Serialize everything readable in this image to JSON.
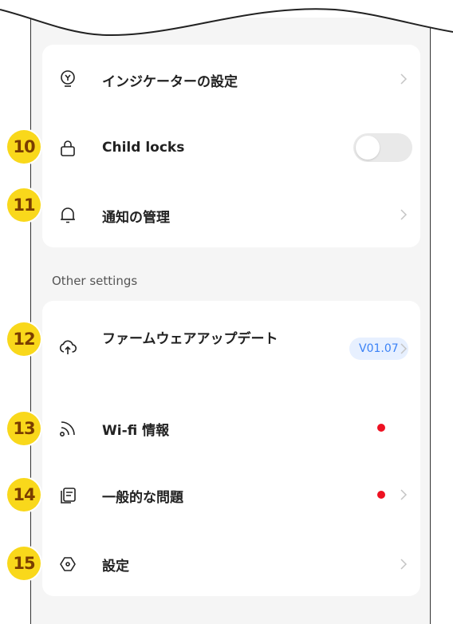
{
  "card1": {
    "rows": [
      {
        "label": "インジケーターの設定",
        "icon": "indicator-icon"
      },
      {
        "label": "Child locks",
        "icon": "lock-icon",
        "toggle": false
      },
      {
        "label": "通知の管理",
        "icon": "bell-icon"
      }
    ]
  },
  "section": {
    "other_settings": "Other settings"
  },
  "card2": {
    "rows": [
      {
        "label": "ファームウェアアップデート",
        "icon": "cloud-upload-icon",
        "version": "V01.07"
      },
      {
        "label": "Wi-fi 情報",
        "icon": "wifi-icon",
        "dot_color": "#ee1122"
      },
      {
        "label": "一般的な問題",
        "icon": "faq-icon",
        "dot_color": "#ee1122"
      },
      {
        "label": "設定",
        "icon": "settings-hexagon-icon"
      }
    ]
  },
  "callouts": [
    "10",
    "11",
    "12",
    "13",
    "14",
    "15"
  ],
  "colors": {
    "accent": "#3b82f6",
    "callout": "#f9d81b",
    "alert": "#ee1122"
  }
}
